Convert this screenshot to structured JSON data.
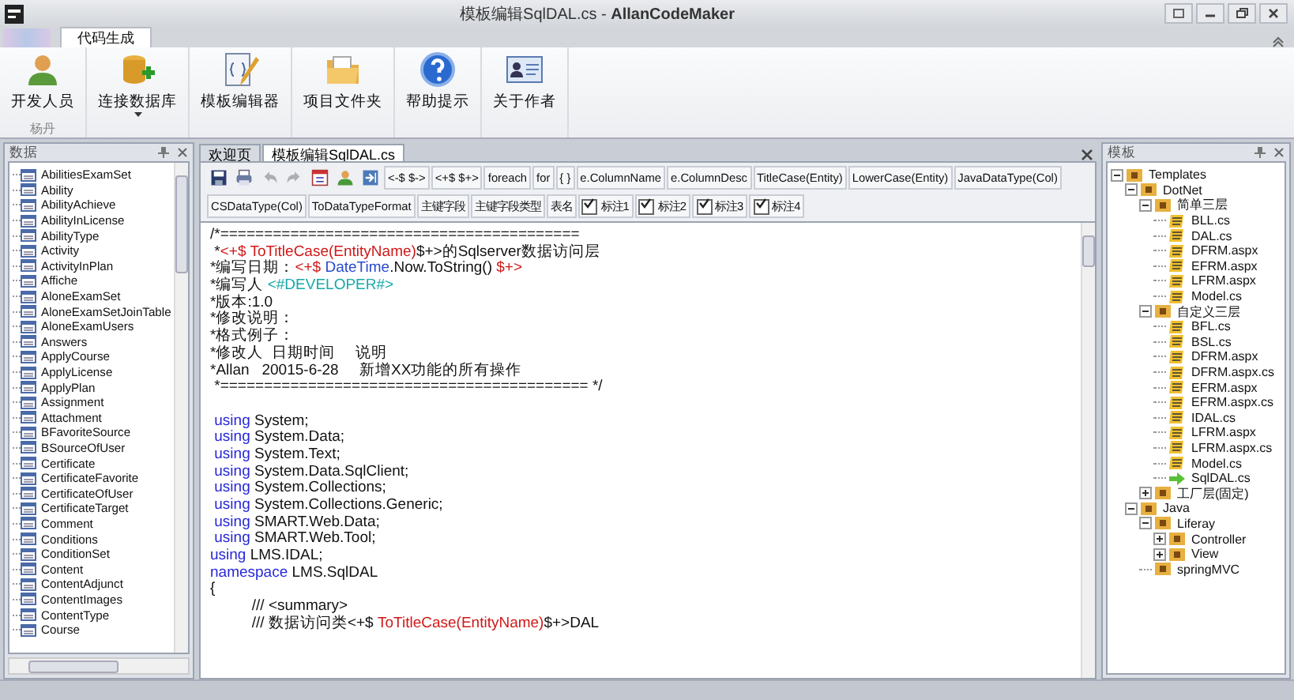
{
  "window": {
    "title": "模板编辑SqlDAL.cs - **AllanCodeMaker**"
  },
  "ribbon": {
    "tabs": [
      {
        "label": "代码生成",
        "selected": true
      }
    ],
    "groups": [
      {
        "label": "杨丹",
        "buttons": [
          {
            "label": "开发人员",
            "kind": "person",
            "dropdown": false
          }
        ]
      },
      {
        "buttons": [
          {
            "label": "连接数据库",
            "kind": "database",
            "dropdown": true
          }
        ]
      },
      {
        "buttons": [
          {
            "label": "模板编辑器",
            "kind": "editor",
            "dropdown": false
          }
        ]
      },
      {
        "buttons": [
          {
            "label": "项目文件夹",
            "kind": "folder",
            "dropdown": false
          }
        ]
      },
      {
        "buttons": [
          {
            "label": "帮助提示",
            "kind": "help",
            "dropdown": false
          }
        ]
      },
      {
        "buttons": [
          {
            "label": "关于作者",
            "kind": "card",
            "dropdown": false
          }
        ]
      }
    ]
  },
  "left_panel": {
    "title": "数据",
    "items": [
      "AbilitiesExamSet",
      "Ability",
      "AbilityAchieve",
      "AbilityInLicense",
      "AbilityType",
      "Activity",
      "ActivityInPlan",
      "Affiche",
      "AloneExamSet",
      "AloneExamSetJoinTable",
      "AloneExamUsers",
      "Answers",
      "ApplyCourse",
      "ApplyLicense",
      "ApplyPlan",
      "Assignment",
      "Attachment",
      "BFavoriteSource",
      "BSourceOfUser",
      "Certificate",
      "CertificateFavorite",
      "CertificateOfUser",
      "CertificateTarget",
      "Comment",
      "Conditions",
      "ConditionSet",
      "Content",
      "ContentAdjunct",
      "ContentImages",
      "ContentType",
      "Course"
    ]
  },
  "editor": {
    "tabs": [
      {
        "label": "欢迎页",
        "selected": false
      },
      {
        "label": "模板编辑SqlDAL.cs",
        "selected": true
      }
    ],
    "toolbar": [
      [
        {
          "kind": "icon",
          "disabled": false
        },
        {
          "kind": "icon",
          "disabled": false
        },
        {
          "kind": "icon",
          "disabled": true
        },
        {
          "kind": "icon",
          "disabled": true
        },
        {
          "kind": "icon",
          "disabled": false
        },
        {
          "kind": "icon",
          "disabled": false
        },
        {
          "kind": "icon",
          "disabled": false
        },
        {
          "kind": "button",
          "label": "<-$ $->"
        },
        {
          "kind": "button",
          "label": "<+$ $+>"
        },
        {
          "kind": "button",
          "label": "foreach"
        },
        {
          "kind": "button",
          "label": "for"
        },
        {
          "kind": "button",
          "label": "{   }"
        },
        {
          "kind": "button",
          "label": "e.ColumnName"
        },
        {
          "kind": "button",
          "label": "e.ColumnDesc"
        },
        {
          "kind": "button",
          "label": "TitleCase(Entity)"
        },
        {
          "kind": "button",
          "label": "LowerCase(Entity)"
        },
        {
          "kind": "button",
          "label": "JavaDataType(Col)"
        }
      ],
      [
        {
          "kind": "button",
          "label": "CSDataType(Col)"
        },
        {
          "kind": "button",
          "label": "ToDataTypeFormat"
        },
        {
          "kind": "button",
          "label": "主键字段"
        },
        {
          "kind": "button",
          "label": "主键字段类型"
        },
        {
          "kind": "button",
          "label": "表名"
        },
        {
          "kind": "checkbox",
          "label": "标注1",
          "checked": true
        },
        {
          "kind": "checkbox",
          "label": "标注2",
          "checked": true
        },
        {
          "kind": "checkbox",
          "label": "标注3",
          "checked": true
        },
        {
          "kind": "checkbox",
          "label": "标注4",
          "checked": true
        }
      ]
    ],
    "code": [
      {
        "segments": [
          {
            "kind": "plain",
            "text": "/*========================================="
          }
        ]
      },
      {
        "segments": [
          {
            "kind": "plain",
            "text": " *"
          },
          {
            "kind": "macro",
            "text": "<+$ ToTitleCase(EntityName)"
          },
          {
            "kind": "plain",
            "text": "$+>的Sqlserver数据访问层"
          }
        ]
      },
      {
        "segments": [
          {
            "kind": "plain",
            "text": "*编写日期："
          },
          {
            "kind": "macro",
            "text": "<+$ "
          },
          {
            "kind": "type",
            "text": "DateTime"
          },
          {
            "kind": "plain",
            "text": ".Now.ToString() "
          },
          {
            "kind": "macro",
            "text": "$+>"
          }
        ]
      },
      {
        "segments": [
          {
            "kind": "plain",
            "text": "*编写人 "
          },
          {
            "kind": "tag",
            "text": "<#DEVELOPER#>"
          }
        ]
      },
      {
        "segments": [
          {
            "kind": "plain",
            "text": "*版本:1.0"
          }
        ]
      },
      {
        "segments": [
          {
            "kind": "plain",
            "text": "*修改说明："
          }
        ]
      },
      {
        "segments": [
          {
            "kind": "plain",
            "text": "*格式例子："
          }
        ]
      },
      {
        "segments": [
          {
            "kind": "plain",
            "text": "*修改人  日期时间     说明"
          }
        ]
      },
      {
        "segments": [
          {
            "kind": "plain",
            "text": "*Allan   20015-6-28     新增XX功能的所有操作"
          }
        ]
      },
      {
        "segments": [
          {
            "kind": "plain",
            "text": " *========================================== */"
          }
        ]
      },
      {
        "blank_before": true,
        "segments": [
          {
            "kind": "keyword",
            "text": " using"
          },
          {
            "kind": "plain",
            "text": " System;"
          }
        ]
      },
      {
        "segments": [
          {
            "kind": "keyword",
            "text": " using"
          },
          {
            "kind": "plain",
            "text": " System.Data;"
          }
        ]
      },
      {
        "segments": [
          {
            "kind": "keyword",
            "text": " using"
          },
          {
            "kind": "plain",
            "text": " System.Text;"
          }
        ]
      },
      {
        "segments": [
          {
            "kind": "keyword",
            "text": " using"
          },
          {
            "kind": "plain",
            "text": " System.Data.SqlClient;"
          }
        ]
      },
      {
        "segments": [
          {
            "kind": "keyword",
            "text": " using"
          },
          {
            "kind": "plain",
            "text": " System.Collections;"
          }
        ]
      },
      {
        "segments": [
          {
            "kind": "keyword",
            "text": " using"
          },
          {
            "kind": "plain",
            "text": " System.Collections.Generic;"
          }
        ]
      },
      {
        "segments": [
          {
            "kind": "keyword",
            "text": " using"
          },
          {
            "kind": "plain",
            "text": " SMART.Web.Data;"
          }
        ]
      },
      {
        "segments": [
          {
            "kind": "keyword",
            "text": " using"
          },
          {
            "kind": "plain",
            "text": " SMART.Web.Tool;"
          }
        ]
      },
      {
        "segments": [
          {
            "kind": "keyword",
            "text": "using"
          },
          {
            "kind": "plain",
            "text": " LMS.IDAL;"
          }
        ]
      },
      {
        "segments": [
          {
            "kind": "keyword",
            "text": "namespace"
          },
          {
            "kind": "plain",
            "text": " LMS.SqlDAL"
          }
        ]
      },
      {
        "segments": [
          {
            "kind": "plain",
            "text": "{"
          }
        ]
      },
      {
        "segments": [
          {
            "kind": "plain",
            "text": "          /// <summary>"
          }
        ]
      },
      {
        "segments": [
          {
            "kind": "plain",
            "text": "          /// 数据访问类<+$ "
          },
          {
            "kind": "macro",
            "text": "ToTitleCase(EntityName)"
          },
          {
            "kind": "plain",
            "text": "$+>DAL"
          }
        ]
      }
    ]
  },
  "right_panel": {
    "title": "模板",
    "tree": [
      {
        "label": "Templates",
        "kind": "folder",
        "expanded": true,
        "children": [
          {
            "label": "DotNet",
            "kind": "folder",
            "expanded": true,
            "children": [
              {
                "label": "简单三层",
                "kind": "folder",
                "expanded": true,
                "children": [
                  {
                    "label": "BLL.cs",
                    "kind": "file"
                  },
                  {
                    "label": "DAL.cs",
                    "kind": "file"
                  },
                  {
                    "label": "DFRM.aspx",
                    "kind": "file"
                  },
                  {
                    "label": "EFRM.aspx",
                    "kind": "file"
                  },
                  {
                    "label": "LFRM.aspx",
                    "kind": "file"
                  },
                  {
                    "label": "Model.cs",
                    "kind": "file"
                  }
                ]
              },
              {
                "label": "自定义三层",
                "kind": "folder",
                "expanded": true,
                "children": [
                  {
                    "label": "BFL.cs",
                    "kind": "file"
                  },
                  {
                    "label": "BSL.cs",
                    "kind": "file"
                  },
                  {
                    "label": "DFRM.aspx",
                    "kind": "file"
                  },
                  {
                    "label": "DFRM.aspx.cs",
                    "kind": "file"
                  },
                  {
                    "label": "EFRM.aspx",
                    "kind": "file"
                  },
                  {
                    "label": "EFRM.aspx.cs",
                    "kind": "file"
                  },
                  {
                    "label": "IDAL.cs",
                    "kind": "file"
                  },
                  {
                    "label": "LFRM.aspx",
                    "kind": "file"
                  },
                  {
                    "label": "LFRM.aspx.cs",
                    "kind": "file"
                  },
                  {
                    "label": "Model.cs",
                    "kind": "file"
                  },
                  {
                    "label": "SqlDAL.cs",
                    "kind": "current"
                  }
                ]
              },
              {
                "label": "工厂层(固定)",
                "kind": "folder",
                "expanded": false
              }
            ]
          },
          {
            "label": "Java",
            "kind": "folder",
            "expanded": true,
            "children": [
              {
                "label": "Liferay",
                "kind": "folder",
                "expanded": true,
                "children": [
                  {
                    "label": "Controller",
                    "kind": "folder",
                    "expanded": false
                  },
                  {
                    "label": "View",
                    "kind": "folder",
                    "expanded": false
                  }
                ]
              },
              {
                "label": "springMVC",
                "kind": "folder"
              }
            ]
          }
        ]
      }
    ]
  }
}
